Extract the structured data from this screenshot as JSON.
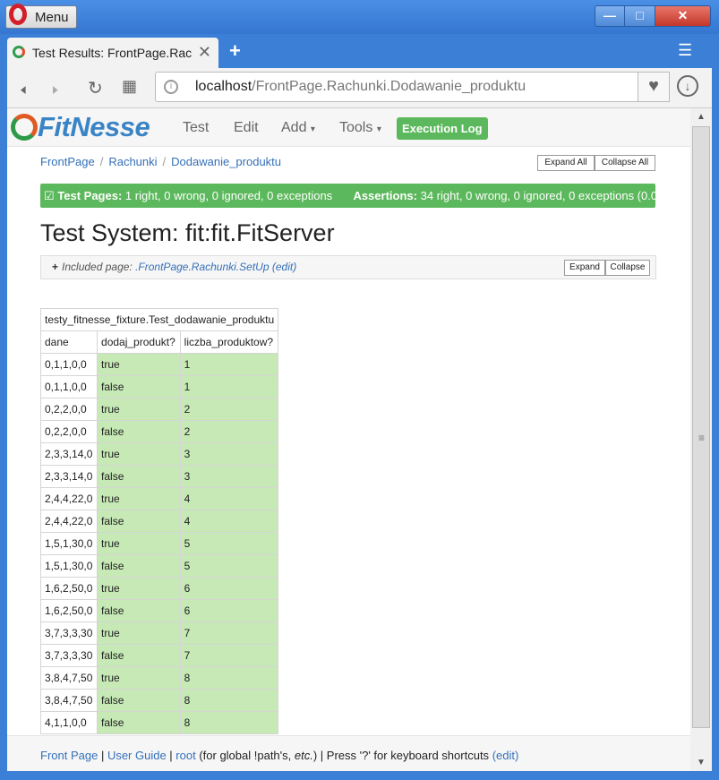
{
  "window": {
    "menu_label": "Menu"
  },
  "tab": {
    "title": "Test Results: FrontPage.Rac"
  },
  "address": {
    "host": "localhost",
    "path": "/FrontPage.Rachunki.Dodawanie_produktu"
  },
  "fitnesse": {
    "logo": "FitNesse",
    "nav": {
      "test": "Test",
      "edit": "Edit",
      "add": "Add",
      "tools": "Tools",
      "exec_log": "Execution Log"
    },
    "breadcrumbs": [
      "FrontPage",
      "Rachunki",
      "Dodawanie_produktu"
    ],
    "expand_all": "Expand All",
    "collapse_all": "Collapse All",
    "summary": {
      "pages_label": "Test Pages:",
      "pages_text": "1 right, 0 wrong, 0 ignored, 0 exceptions",
      "assert_label": "Assertions:",
      "assert_text": "34 right, 0 wrong, 0 ignored, 0 exceptions (0.0"
    },
    "test_system": "Test System: fit:fit.FitServer",
    "included": {
      "plus": "+",
      "prefix": "Included page:",
      "link": ".FrontPage.Rachunki.SetUp",
      "edit": "(edit)",
      "expand": "Expand",
      "collapse": "Collapse"
    },
    "table": {
      "fixture": "testy_fitnesse_fixture.Test_dodawanie_produktu",
      "headers": [
        "dane",
        "dodaj_produkt?",
        "liczba_produktow?"
      ],
      "rows": [
        [
          "0,1,1,0,0",
          "true",
          "1"
        ],
        [
          "0,1,1,0,0",
          "false",
          "1"
        ],
        [
          "0,2,2,0,0",
          "true",
          "2"
        ],
        [
          "0,2,2,0,0",
          "false",
          "2"
        ],
        [
          "2,3,3,14,0",
          "true",
          "3"
        ],
        [
          "2,3,3,14,0",
          "false",
          "3"
        ],
        [
          "2,4,4,22,0",
          "true",
          "4"
        ],
        [
          "2,4,4,22,0",
          "false",
          "4"
        ],
        [
          "1,5,1,30,0",
          "true",
          "5"
        ],
        [
          "1,5,1,30,0",
          "false",
          "5"
        ],
        [
          "1,6,2,50,0",
          "true",
          "6"
        ],
        [
          "1,6,2,50,0",
          "false",
          "6"
        ],
        [
          "3,7,3,3,30",
          "true",
          "7"
        ],
        [
          "3,7,3,3,30",
          "false",
          "7"
        ],
        [
          "3,8,4,7,50",
          "true",
          "8"
        ],
        [
          "3,8,4,7,50",
          "false",
          "8"
        ],
        [
          "4,1,1,0,0",
          "false",
          "8"
        ]
      ]
    },
    "footer": {
      "front_page": "Front Page",
      "user_guide": "User Guide",
      "root": "root",
      "root_note_a": "(for global !path's,",
      "root_note_etc": "etc.",
      "root_note_b": ") | Press '?' for keyboard shortcuts",
      "edit": "(edit)"
    }
  },
  "colors": {
    "pass_bar": "#5cb85c",
    "pass_cell": "#c6e9b5",
    "link": "#3570b8",
    "logo": "#3a84c6"
  }
}
